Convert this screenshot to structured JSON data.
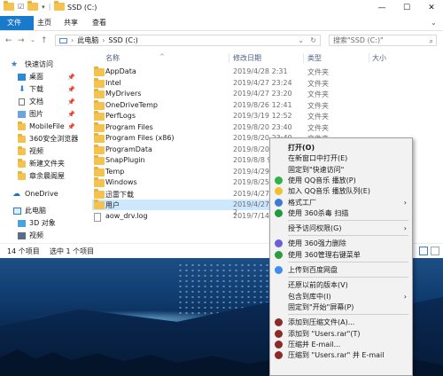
{
  "window": {
    "title": "SSD (C:)",
    "controls": [
      "—",
      "☐",
      "✕"
    ]
  },
  "ribbon": {
    "tabs": [
      "文件",
      "主页",
      "共享",
      "查看"
    ]
  },
  "address": {
    "path": [
      "此电脑",
      "SSD (C:)"
    ],
    "search_placeholder": "搜索\"SSD (C:)\""
  },
  "navpane": {
    "items": [
      {
        "label": "快速访问",
        "pinned": false
      },
      {
        "label": "桌面",
        "pinned": true
      },
      {
        "label": "下载",
        "pinned": true
      },
      {
        "label": "文档",
        "pinned": true
      },
      {
        "label": "图片",
        "pinned": true
      },
      {
        "label": "MobileFile",
        "pinned": true
      },
      {
        "label": "360安全浏览器",
        "pinned": false
      },
      {
        "label": "视频",
        "pinned": false
      },
      {
        "label": "新建文件夹",
        "pinned": false
      },
      {
        "label": "章余晨阁屋",
        "pinned": false
      },
      {
        "label": "OneDrive",
        "pinned": false
      },
      {
        "label": "此电脑",
        "pinned": false
      },
      {
        "label": "3D 对象",
        "pinned": false
      },
      {
        "label": "视频",
        "pinned": false
      }
    ]
  },
  "list": {
    "headers": {
      "name": "名称",
      "date": "修改日期",
      "type": "类型",
      "size": "大小"
    },
    "rows": [
      {
        "name": "AppData",
        "date": "2019/4/28 2:31",
        "type": "文件夹",
        "kind": "folder"
      },
      {
        "name": "Intel",
        "date": "2019/4/27 23:24",
        "type": "文件夹",
        "kind": "folder"
      },
      {
        "name": "MyDrivers",
        "date": "2019/4/27 23:20",
        "type": "文件夹",
        "kind": "folder"
      },
      {
        "name": "OneDriveTemp",
        "date": "2019/8/26 12:41",
        "type": "文件夹",
        "kind": "folder"
      },
      {
        "name": "PerfLogs",
        "date": "2019/3/19 12:52",
        "type": "文件夹",
        "kind": "folder"
      },
      {
        "name": "Program Files",
        "date": "2019/8/20 23:40",
        "type": "文件夹",
        "kind": "folder"
      },
      {
        "name": "Program Files (x86)",
        "date": "2019/8/20 23:40",
        "type": "文件夹",
        "kind": "folder"
      },
      {
        "name": "ProgramData",
        "date": "2019/8/20 23:40",
        "type": "文件夹",
        "kind": "folder"
      },
      {
        "name": "SnapPlugin",
        "date": "2019/8/8 9:",
        "type": "",
        "kind": "folder"
      },
      {
        "name": "Temp",
        "date": "2019/4/29 1",
        "type": "",
        "kind": "folder"
      },
      {
        "name": "Windows",
        "date": "2019/8/25 1",
        "type": "",
        "kind": "folder"
      },
      {
        "name": "迅雷下载",
        "date": "2019/4/27 2",
        "type": "",
        "kind": "folder"
      },
      {
        "name": "用户",
        "date": "2019/4/27 2",
        "type": "",
        "kind": "folder",
        "selected": true
      },
      {
        "name": "aow_drv.log",
        "date": "2019/7/14 1",
        "type": "",
        "kind": "file"
      }
    ]
  },
  "statusbar": {
    "count": "14 个项目",
    "selected": "选中 1 个项目"
  },
  "context_menu": {
    "items": [
      {
        "label": "打开(O)",
        "bold": true
      },
      {
        "label": "在新窗口中打开(E)"
      },
      {
        "label": "固定到\"快速访问\""
      },
      {
        "label": "使用 QQ音乐 播放(P)",
        "icon": "#2fb24a"
      },
      {
        "label": "加入 QQ音乐 播放队列(E)",
        "icon": "#f2c029"
      },
      {
        "label": "格式工厂",
        "arrow": true,
        "icon": "#3a7bd5"
      },
      {
        "label": "使用 360杀毒 扫描",
        "icon": "#1e9b3e"
      },
      {
        "sep": true
      },
      {
        "label": "授予访问权限(G)",
        "arrow": true
      },
      {
        "sep": true
      },
      {
        "label": "使用 360强力删除",
        "icon": "#6b5fd6"
      },
      {
        "label": "使用 360管理右键菜单",
        "icon": "#2c9c3d"
      },
      {
        "sep": true
      },
      {
        "label": "上传到百度网盘",
        "icon": "#3b8ef0"
      },
      {
        "sep": true
      },
      {
        "label": "还原以前的版本(V)"
      },
      {
        "label": "包含到库中(I)",
        "arrow": true
      },
      {
        "label": "固定到\"开始\"屏幕(P)"
      },
      {
        "sep": true
      },
      {
        "label": "添加到压缩文件(A)...",
        "icon": "#8c2a2a"
      },
      {
        "label": "添加到 \"Users.rar\"(T)",
        "icon": "#8c2a2a"
      },
      {
        "label": "压缩并 E-mail...",
        "icon": "#8c2a2a"
      },
      {
        "label": "压缩到 \"Users.rar\" 并 E-mail",
        "icon": "#8c2a2a"
      }
    ]
  }
}
